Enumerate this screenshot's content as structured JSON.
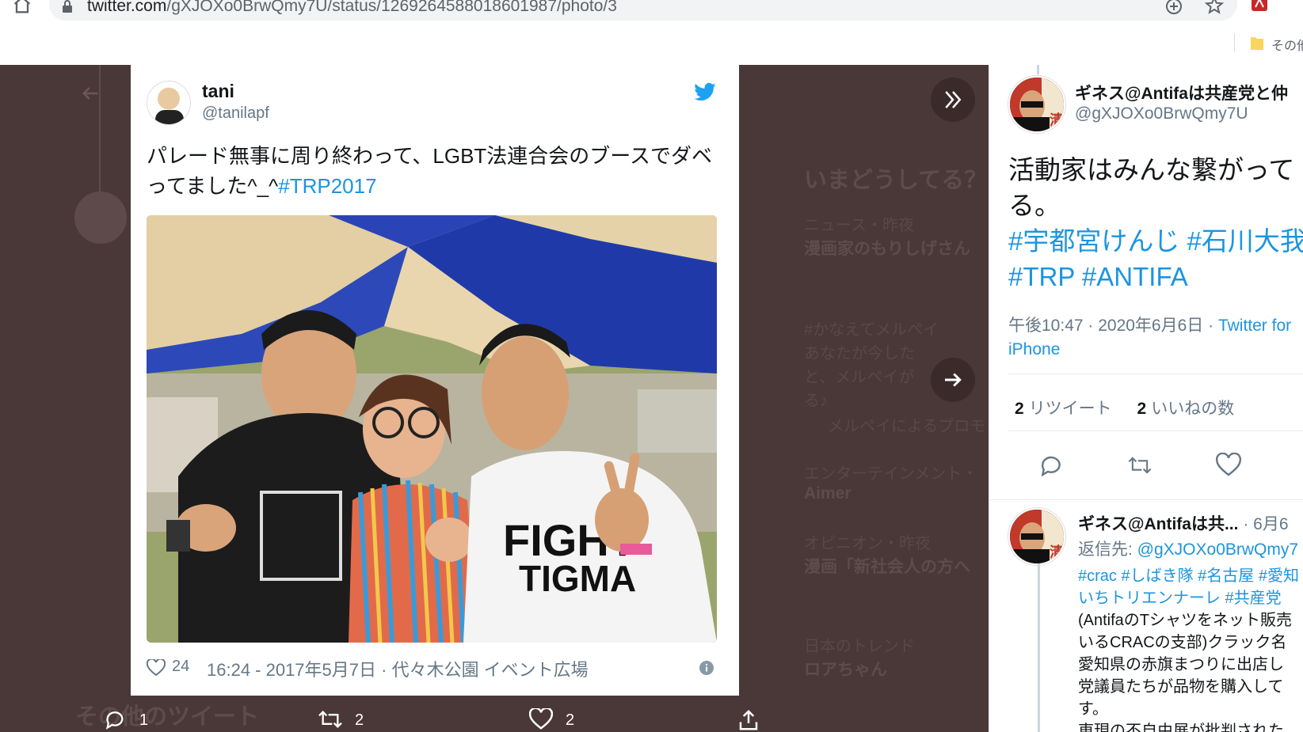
{
  "browser": {
    "url_host": "twitter.com",
    "url_path": "/gXJOXo0BrwQmy7U/status/1269264588018601987/photo/3",
    "bookmark_label": "その他"
  },
  "background": {
    "whats_happening": "いまどうしてる？",
    "trend1_meta": "ニュース・昨夜",
    "trend1_title": "漫画家のもりしげさん",
    "promo_tag": "#かなえてメルペイ",
    "promo_desc1": "あなたが今した",
    "promo_desc2": "と、メルペイが",
    "promo_desc3": "る♪",
    "promo_by": "メルペイによるプロモ",
    "trend2_meta": "エンターテインメント・",
    "trend2_title": "Aimer",
    "trend3_meta": "オピニオン・昨夜",
    "trend3_title": "漫画「新社会人の方へ",
    "trend4_meta": "日本のトレンド",
    "trend4_title": "ロアちゃん",
    "other_tweets": "その他のツイート"
  },
  "card": {
    "name": "tani",
    "handle": "@tanilapf",
    "text": "パレード無事に周り終わって、LGBT法連合会のブースでダベってました^_^",
    "hashtag": "#TRP2017",
    "likes": "24",
    "date": "16:24 - 2017年5月7日 · 代々木公園 イベント広場"
  },
  "bottom_actions": {
    "replies": "1",
    "retweets": "2",
    "likes": "2"
  },
  "right_panel": {
    "name": "ギネス@Antifaは共産党と仲",
    "handle": "@gXJOXo0BrwQmy7U",
    "text_line1": "活動家はみんな繋がって",
    "text_line2": "る。",
    "hashtags_line1": "#宇都宮けんじ #石川大我",
    "hashtags_line2": "#TRP #ANTIFA",
    "time": "午後10:47 · 2020年6月6日 · ",
    "source": "Twitter for",
    "source2": "iPhone",
    "retweets_count": "2",
    "retweets_label": "リツイート",
    "likes_count": "2",
    "likes_label": "いいねの数",
    "reply": {
      "name": "ギネス@Antifaは共...",
      "date": " · 6月6",
      "reply_to_label": "返信先: ",
      "reply_to_handle": "@gXJOXo0BrwQmy7",
      "tags_line1": "#crac #しばき隊 #名古屋 #愛知",
      "tags_line2": "いちトリエンナーレ #共産党",
      "body1": "(AntifaのTシャツをネット販売",
      "body2": "いるCRACの支部)クラック名",
      "body3": "愛知県の赤旗まつりに出店し",
      "body4": "党議員たちが品物を購入して",
      "body5": "す。",
      "body6": "東現の不自由展が批判された"
    }
  }
}
